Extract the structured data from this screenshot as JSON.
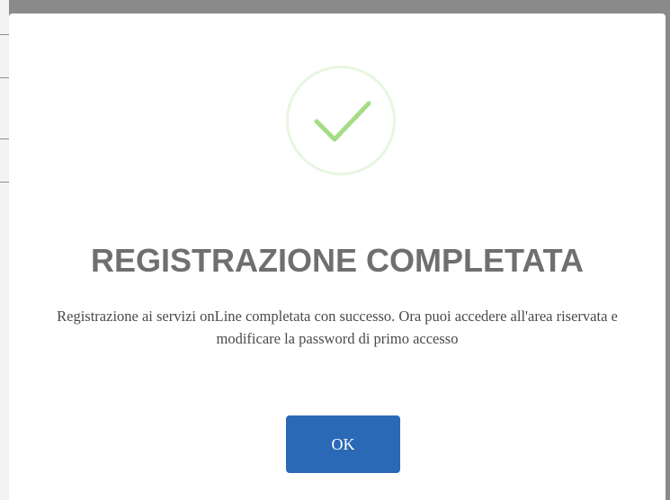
{
  "dialog": {
    "icon": "check-icon",
    "title": "REGISTRAZIONE COMPLETATA",
    "message": "Registrazione ai servizi onLine completata con successo. Ora puoi accedere all'area riservata e modificare la password di primo accesso",
    "ok_label": "OK"
  },
  "colors": {
    "overlay": "#8a8a8a",
    "check": "#a5dc86",
    "title": "#6f6f6f",
    "button": "#2a69b6"
  }
}
